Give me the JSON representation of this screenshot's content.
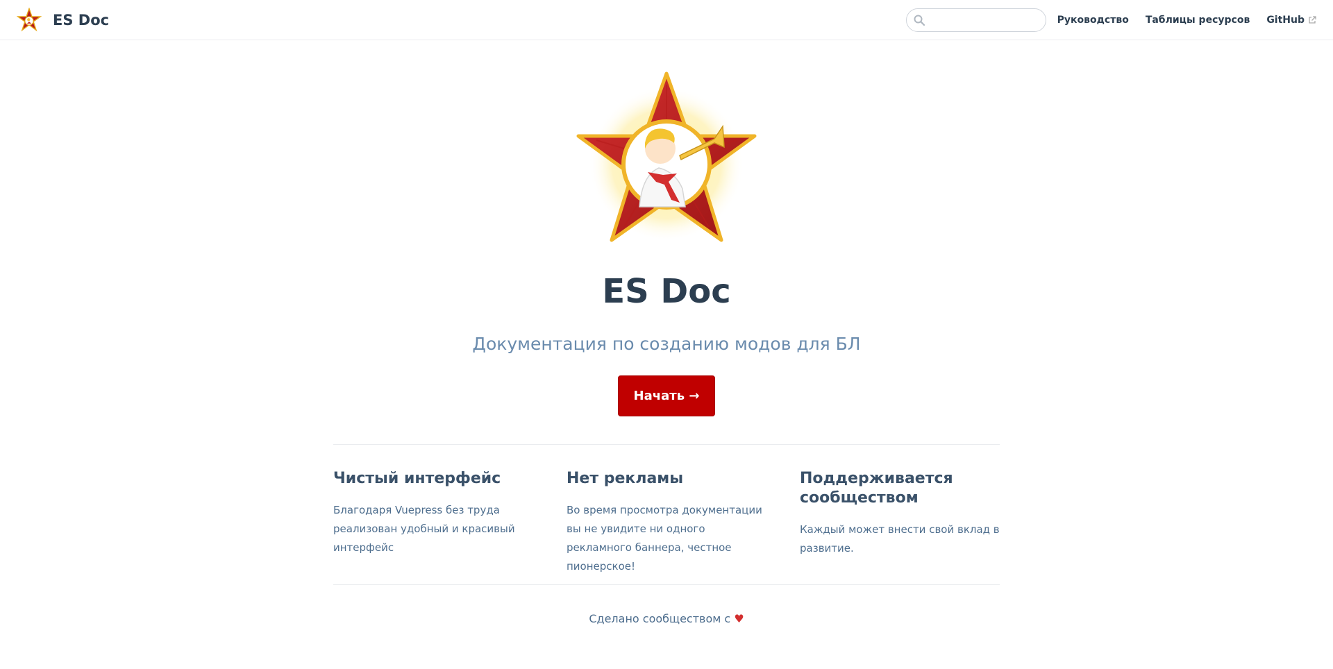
{
  "navbar": {
    "site_name": "ES Doc",
    "search": {
      "value": "",
      "placeholder": ""
    },
    "links": [
      {
        "label": "Руководство",
        "icon": ""
      },
      {
        "label": "Таблицы ресурсов",
        "icon": ""
      },
      {
        "label": "GitHub",
        "icon": "external-link-icon"
      }
    ]
  },
  "hero": {
    "logo_icon": "red-star-pioneer-logo",
    "title": "ES Doc",
    "description": "Документация по созданию модов для БЛ",
    "action_label": "Начать →",
    "action_color": "#c00000"
  },
  "features": [
    {
      "title": "Чистый интерфейс",
      "details": "Благодаря Vuepress без труда реализован удобный и красивый интерфейс"
    },
    {
      "title": "Нет рекламы",
      "details": "Во время просмотра документации вы не увидите ни одного рекламного баннера, честное пионерское!"
    },
    {
      "title": "Поддерживается сообществом",
      "details": "Каждый может внести свой вклад в развитие."
    }
  ],
  "footer": {
    "text": "Сделано сообществом с",
    "heart": "♥"
  },
  "colors": {
    "accent": "#c00000",
    "text": "#2c3e50",
    "muted": "#6a8bad"
  }
}
